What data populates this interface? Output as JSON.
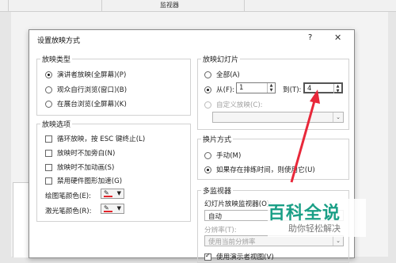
{
  "topbar": {
    "label": "监视器"
  },
  "dialog": {
    "title": "设置放映方式",
    "help": "?",
    "close": "✕",
    "show_type": {
      "title": "放映类型",
      "options": [
        {
          "label": "演讲者放映(全屏幕)(P)",
          "selected": true
        },
        {
          "label": "观众自行浏览(窗口)(B)",
          "selected": false
        },
        {
          "label": "在展台浏览(全屏幕)(K)",
          "selected": false
        }
      ]
    },
    "show_options": {
      "title": "放映选项",
      "checks": [
        {
          "label": "循环放映，按 ESC 键终止(L)",
          "checked": false
        },
        {
          "label": "放映时不加旁白(N)",
          "checked": false
        },
        {
          "label": "放映时不加动画(S)",
          "checked": false
        },
        {
          "label": "禁用硬件图形加速(G)",
          "checked": false
        }
      ],
      "pen_color_label": "绘图笔颜色(E):",
      "laser_color_label": "激光笔颜色(R):"
    },
    "slides": {
      "title": "放映幻灯片",
      "all_label": "全部(A)",
      "from_label": "从(F):",
      "from_value": "1",
      "to_label": "到(T):",
      "to_value": "4",
      "custom_label": "自定义放映(C):"
    },
    "advance": {
      "title": "换片方式",
      "manual_label": "手动(M)",
      "timing_label": "如果存在排练时间，则使用它(U)"
    },
    "monitors": {
      "title": "多监视器",
      "monitor_label": "幻灯片放映监视器(O):",
      "monitor_value": "自动",
      "resolution_label": "分辨率(T):",
      "resolution_value": "使用当前分辨率",
      "presenter_view_label": "使用演示者视图(V)"
    }
  },
  "watermark": {
    "main": "百科全说",
    "sub": "助你轻松解决"
  },
  "colors": {
    "accent_arrow": "#e8283a",
    "pen": "#e3242b",
    "watermark": "#1a9f86"
  }
}
